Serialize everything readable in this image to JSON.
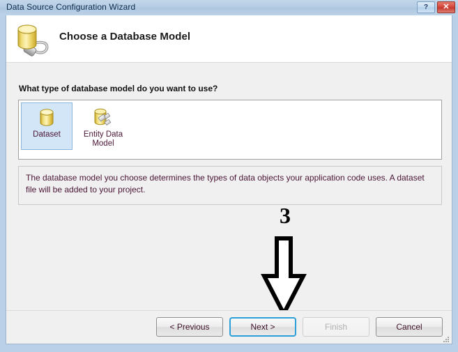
{
  "window": {
    "title": "Data Source Configuration Wizard",
    "help_button": "?",
    "close_button": "✕"
  },
  "header": {
    "title": "Choose a Database Model",
    "icon": "database-plug-icon"
  },
  "main": {
    "prompt": "What type of database model do you want to use?",
    "options": [
      {
        "label": "Dataset",
        "icon": "database-cylinder-icon",
        "selected": true
      },
      {
        "label": "Entity Data Model",
        "icon": "entity-data-model-icon",
        "selected": false
      }
    ],
    "description": "The database model you choose determines the types of data objects your application code uses. A dataset file will be added to your project."
  },
  "annotation": {
    "number": "3",
    "arrow": "down-arrow-icon"
  },
  "footer": {
    "buttons": [
      {
        "label": "< Previous",
        "state": "enabled"
      },
      {
        "label": "Next >",
        "state": "default"
      },
      {
        "label": "Finish",
        "state": "disabled"
      },
      {
        "label": "Cancel",
        "state": "enabled"
      }
    ]
  },
  "colors": {
    "titlebar": "#b6cde4",
    "selection": "#d2e6f7",
    "default_button_border": "#2a9fd8",
    "close_button": "#c43529",
    "text": "#4a1535"
  }
}
